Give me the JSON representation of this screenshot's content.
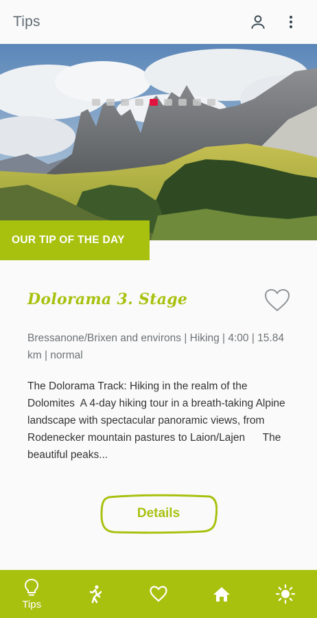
{
  "appbar": {
    "title": "Tips",
    "profile_icon": "account-icon",
    "menu_icon": "more-vert-icon"
  },
  "carousel": {
    "slide_count": 10,
    "active_index": 4,
    "image": "mountain-landscape-photo"
  },
  "banner": {
    "label": "OUR TIP OF THE DAY"
  },
  "tip": {
    "title": "Dolorama 3. Stage",
    "meta": "Bressanone/Brixen and environs | Hiking | 4:00 | 15.84 km | normal",
    "description": "The Dolorama Track: Hiking in the realm of the Dolomites  A 4-day hiking tour in a breath-taking Alpine landscape with spectacular panoramic views, from Rodenecker mountain pastures to Laion/Lajen      The beautiful peaks...",
    "details_label": "Details",
    "favorite_icon": "heart-outline-icon"
  },
  "bottom_nav": {
    "items": [
      {
        "label": "Tips",
        "icon": "lightbulb-icon",
        "active": true
      },
      {
        "label": "",
        "icon": "hiker-icon",
        "active": false
      },
      {
        "label": "",
        "icon": "heart-icon",
        "active": false
      },
      {
        "label": "",
        "icon": "home-icon",
        "active": false
      },
      {
        "label": "",
        "icon": "sun-icon",
        "active": false
      }
    ]
  },
  "colors": {
    "accent": "#a8c10f",
    "active_dot": "#e2133f",
    "title_text": "#5f6b73"
  }
}
